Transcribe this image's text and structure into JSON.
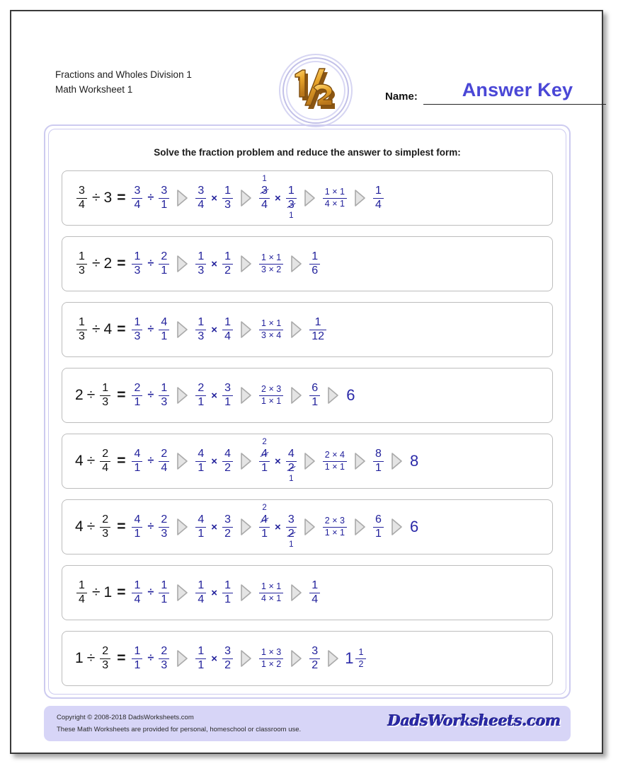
{
  "header": {
    "title_line1": "Fractions and Wholes Division 1",
    "title_line2": "Math Worksheet 1",
    "name_label": "Name:",
    "answer_key": "Answer Key",
    "logo_alt": "half-fraction-logo"
  },
  "instructions": "Solve the fraction problem and reduce the answer to simplest form:",
  "footer": {
    "copyright": "Copyright © 2008-2018 DadsWorksheets.com",
    "usage": "These Math Worksheets are provided for personal, homeschool or classroom use.",
    "logo_text": "DadsWorksheets.com"
  },
  "colors": {
    "answer_blue": "#23229c",
    "answer_key_blue": "#4a47d6",
    "frame_lavender": "#cdcbf0",
    "footer_band": "#d7d5f7",
    "problem_border": "#bdbdbd",
    "arrow_fill": "#e4e4e4",
    "arrow_stroke": "#aaaaaa",
    "black_text": "#111111"
  },
  "problems": [
    {
      "id": 1,
      "question": {
        "left": {
          "num": "3",
          "den": "4"
        },
        "op": "÷",
        "right_whole": "3"
      },
      "steps": [
        {
          "type": "divide",
          "a": {
            "num": "3",
            "den": "4"
          },
          "b": {
            "num": "3",
            "den": "1"
          }
        },
        {
          "type": "multiply",
          "a": {
            "num": "3",
            "den": "4"
          },
          "b": {
            "num": "1",
            "den": "3"
          }
        },
        {
          "type": "multiply_cancel",
          "a": {
            "num": "3",
            "den": "4",
            "num_cancel": "1"
          },
          "b": {
            "num": "1",
            "den": "3",
            "den_cancel": "1"
          }
        },
        {
          "type": "product",
          "num": "1 × 1",
          "den": "4 × 1"
        },
        {
          "type": "fraction",
          "num": "1",
          "den": "4"
        }
      ]
    },
    {
      "id": 2,
      "question": {
        "left": {
          "num": "1",
          "den": "3"
        },
        "op": "÷",
        "right_whole": "2"
      },
      "steps": [
        {
          "type": "divide",
          "a": {
            "num": "1",
            "den": "3"
          },
          "b": {
            "num": "2",
            "den": "1"
          }
        },
        {
          "type": "multiply",
          "a": {
            "num": "1",
            "den": "3"
          },
          "b": {
            "num": "1",
            "den": "2"
          }
        },
        {
          "type": "product",
          "num": "1 × 1",
          "den": "3 × 2"
        },
        {
          "type": "fraction",
          "num": "1",
          "den": "6"
        }
      ]
    },
    {
      "id": 3,
      "question": {
        "left": {
          "num": "1",
          "den": "3"
        },
        "op": "÷",
        "right_whole": "4"
      },
      "steps": [
        {
          "type": "divide",
          "a": {
            "num": "1",
            "den": "3"
          },
          "b": {
            "num": "4",
            "den": "1"
          }
        },
        {
          "type": "multiply",
          "a": {
            "num": "1",
            "den": "3"
          },
          "b": {
            "num": "1",
            "den": "4"
          }
        },
        {
          "type": "product",
          "num": "1 × 1",
          "den": "3 × 4"
        },
        {
          "type": "fraction",
          "num": "1",
          "den": "12"
        }
      ]
    },
    {
      "id": 4,
      "question": {
        "left_whole": "2",
        "op": "÷",
        "right": {
          "num": "1",
          "den": "3"
        }
      },
      "steps": [
        {
          "type": "divide",
          "a": {
            "num": "2",
            "den": "1"
          },
          "b": {
            "num": "1",
            "den": "3"
          }
        },
        {
          "type": "multiply",
          "a": {
            "num": "2",
            "den": "1"
          },
          "b": {
            "num": "3",
            "den": "1"
          }
        },
        {
          "type": "product",
          "num": "2 × 3",
          "den": "1 × 1"
        },
        {
          "type": "fraction",
          "num": "6",
          "den": "1"
        },
        {
          "type": "whole",
          "value": "6"
        }
      ]
    },
    {
      "id": 5,
      "question": {
        "left_whole": "4",
        "op": "÷",
        "right": {
          "num": "2",
          "den": "4"
        }
      },
      "steps": [
        {
          "type": "divide",
          "a": {
            "num": "4",
            "den": "1"
          },
          "b": {
            "num": "2",
            "den": "4"
          }
        },
        {
          "type": "multiply",
          "a": {
            "num": "4",
            "den": "1"
          },
          "b": {
            "num": "4",
            "den": "2"
          }
        },
        {
          "type": "multiply_cancel",
          "a": {
            "num": "4",
            "den": "1",
            "num_cancel": "2"
          },
          "b": {
            "num": "4",
            "den": "2",
            "den_cancel": "1"
          }
        },
        {
          "type": "product",
          "num": "2 × 4",
          "den": "1 × 1"
        },
        {
          "type": "fraction",
          "num": "8",
          "den": "1"
        },
        {
          "type": "whole",
          "value": "8"
        }
      ]
    },
    {
      "id": 6,
      "question": {
        "left_whole": "4",
        "op": "÷",
        "right": {
          "num": "2",
          "den": "3"
        }
      },
      "steps": [
        {
          "type": "divide",
          "a": {
            "num": "4",
            "den": "1"
          },
          "b": {
            "num": "2",
            "den": "3"
          }
        },
        {
          "type": "multiply",
          "a": {
            "num": "4",
            "den": "1"
          },
          "b": {
            "num": "3",
            "den": "2"
          }
        },
        {
          "type": "multiply_cancel",
          "a": {
            "num": "4",
            "den": "1",
            "num_cancel": "2"
          },
          "b": {
            "num": "3",
            "den": "2",
            "den_cancel": "1"
          }
        },
        {
          "type": "product",
          "num": "2 × 3",
          "den": "1 × 1"
        },
        {
          "type": "fraction",
          "num": "6",
          "den": "1"
        },
        {
          "type": "whole",
          "value": "6"
        }
      ]
    },
    {
      "id": 7,
      "question": {
        "left": {
          "num": "1",
          "den": "4"
        },
        "op": "÷",
        "right_whole": "1"
      },
      "steps": [
        {
          "type": "divide",
          "a": {
            "num": "1",
            "den": "4"
          },
          "b": {
            "num": "1",
            "den": "1"
          }
        },
        {
          "type": "multiply",
          "a": {
            "num": "1",
            "den": "4"
          },
          "b": {
            "num": "1",
            "den": "1"
          }
        },
        {
          "type": "product",
          "num": "1 × 1",
          "den": "4 × 1"
        },
        {
          "type": "fraction",
          "num": "1",
          "den": "4"
        }
      ]
    },
    {
      "id": 8,
      "question": {
        "left_whole": "1",
        "op": "÷",
        "right": {
          "num": "2",
          "den": "3"
        }
      },
      "steps": [
        {
          "type": "divide",
          "a": {
            "num": "1",
            "den": "1"
          },
          "b": {
            "num": "2",
            "den": "3"
          }
        },
        {
          "type": "multiply",
          "a": {
            "num": "1",
            "den": "1"
          },
          "b": {
            "num": "3",
            "den": "2"
          }
        },
        {
          "type": "product",
          "num": "1 × 3",
          "den": "1 × 2"
        },
        {
          "type": "fraction",
          "num": "3",
          "den": "2"
        },
        {
          "type": "mixed",
          "whole": "1",
          "num": "1",
          "den": "2"
        }
      ]
    }
  ]
}
